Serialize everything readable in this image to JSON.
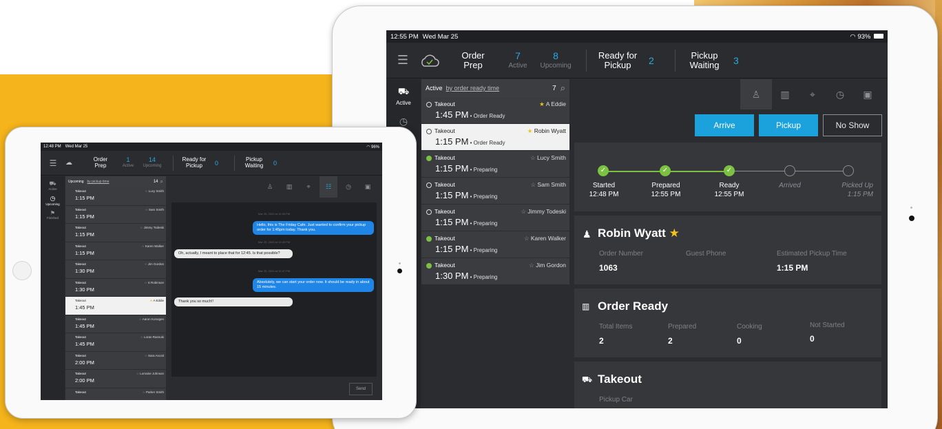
{
  "colors": {
    "accent": "#29a9e1",
    "green": "#7cc142",
    "gold": "#f3c21d",
    "yellow_bg": "#f5b41c"
  },
  "big": {
    "status": {
      "time": "12:55 PM",
      "date": "Wed Mar 25",
      "battery": "93%"
    },
    "header": {
      "order_prep": "Order\nPrep",
      "active_num": "7",
      "active_label": "Active",
      "upcoming_num": "8",
      "upcoming_label": "Upcoming",
      "ready_label": "Ready for\nPickup",
      "ready_num": "2",
      "waiting_label": "Pickup\nWaiting",
      "waiting_num": "3"
    },
    "sidebar": {
      "active_label": "Active"
    },
    "list": {
      "tab": "Active",
      "sort": "by order ready time",
      "count": "7",
      "rows": [
        {
          "type": "Takeout",
          "name": "A Eddie",
          "time": "1:45 PM",
          "status": "Order Ready",
          "starred": true,
          "dot": "empty",
          "selected": false
        },
        {
          "type": "Takeout",
          "name": "Robin Wyatt",
          "time": "1:15 PM",
          "status": "Order Ready",
          "starred": true,
          "dot": "empty",
          "selected": true
        },
        {
          "type": "Takeout",
          "name": "Lucy Smith",
          "time": "1:15 PM",
          "status": "Preparing",
          "starred": false,
          "dot": "green",
          "selected": false
        },
        {
          "type": "Takeout",
          "name": "Sam Smith",
          "time": "1:15 PM",
          "status": "Preparing",
          "starred": false,
          "dot": "empty",
          "selected": false
        },
        {
          "type": "Takeout",
          "name": "Jimmy Todeski",
          "time": "1:15 PM",
          "status": "Preparing",
          "starred": false,
          "dot": "empty",
          "selected": false
        },
        {
          "type": "Takeout",
          "name": "Karen Walker",
          "time": "1:15 PM",
          "status": "Preparing",
          "starred": false,
          "dot": "green",
          "selected": false
        },
        {
          "type": "Takeout",
          "name": "Jim Gordon",
          "time": "1:30 PM",
          "status": "Preparing",
          "starred": false,
          "dot": "green",
          "selected": false
        }
      ]
    },
    "buttons": {
      "arrive": "Arrive",
      "pickup": "Pickup",
      "no_show": "No Show"
    },
    "progress": {
      "steps": [
        {
          "label": "Started",
          "time": "12:48 PM",
          "done": true
        },
        {
          "label": "Prepared",
          "time": "12:55 PM",
          "done": true
        },
        {
          "label": "Ready",
          "time": "12:55 PM",
          "done": true
        },
        {
          "label": "Arrived",
          "time": "",
          "done": false
        },
        {
          "label": "Picked Up",
          "time": "1:15 PM",
          "done": false
        }
      ]
    },
    "customer": {
      "name": "Robin Wyatt",
      "order_number_label": "Order Number",
      "order_number": "1063",
      "guest_phone_label": "Guest Phone",
      "pickup_time_label": "Estimated Pickup Time",
      "pickup_time": "1:15 PM"
    },
    "order": {
      "title": "Order Ready",
      "total_label": "Total Items",
      "total": "2",
      "prepared_label": "Prepared",
      "prepared": "2",
      "cooking_label": "Cooking",
      "cooking": "0",
      "not_started_label": "Not Started",
      "not_started": "0"
    },
    "takeout": {
      "title": "Takeout",
      "pickup_car_label": "Pickup Car"
    }
  },
  "small": {
    "status": {
      "time": "12:48 PM",
      "date": "Wed Mar 25",
      "battery": "96%"
    },
    "header": {
      "order_prep": "Order\nPrep",
      "active_num": "1",
      "active_label": "Active",
      "upcoming_num": "14",
      "upcoming_label": "Upcoming",
      "ready_label": "Ready for\nPickup",
      "ready_num": "0",
      "waiting_label": "Pickup\nWaiting",
      "waiting_num": "0"
    },
    "sidebar": {
      "active": "Active",
      "upcoming": "Upcoming",
      "finished": "Finished"
    },
    "list": {
      "tab": "Upcoming",
      "sort": "by pickup time",
      "count": "14",
      "rows": [
        {
          "type": "Takeout",
          "name": "Lucy Smith",
          "time": "1:15 PM",
          "starred": false,
          "selected": false
        },
        {
          "type": "Takeout",
          "name": "Sam Smith",
          "time": "1:15 PM",
          "starred": false,
          "selected": false
        },
        {
          "type": "Takeout",
          "name": "Jimmy Todeski",
          "time": "1:15 PM",
          "starred": false,
          "selected": false
        },
        {
          "type": "Takeout",
          "name": "Karen Walker",
          "time": "1:15 PM",
          "starred": false,
          "selected": false
        },
        {
          "type": "Takeout",
          "name": "Jim Gordon",
          "time": "1:30 PM",
          "starred": false,
          "selected": false
        },
        {
          "type": "Takeout",
          "name": "S Robinson",
          "time": "1:30 PM",
          "starred": false,
          "selected": false
        },
        {
          "type": "Takeout",
          "name": "A Eddie",
          "time": "1:45 PM",
          "starred": true,
          "selected": true
        },
        {
          "type": "Takeout",
          "name": "Aaron Konogen",
          "time": "1:45 PM",
          "starred": false,
          "selected": false
        },
        {
          "type": "Takeout",
          "name": "Loran Rasnuki",
          "time": "1:45 PM",
          "starred": false,
          "selected": false
        },
        {
          "type": "Takeout",
          "name": "Sara Ascott",
          "time": "2:00 PM",
          "starred": false,
          "selected": false
        },
        {
          "type": "Takeout",
          "name": "Lorraine Johnson",
          "time": "2:00 PM",
          "starred": false,
          "selected": false
        },
        {
          "type": "Takeout",
          "name": "Parker Smith",
          "time": "",
          "starred": false,
          "selected": false
        }
      ]
    },
    "chat": {
      "ts1": "Mar 25, 2020 at 12:43 PM",
      "msg1": "Hello, this is The Friday Cafe. Just wanted to confirm your pickup order for 1:45pm today. Thank you.",
      "ts2": "Mar 25, 2020 at 12:45 PM",
      "msg2": "Oh, actually, I meant to place that for 12:45. Is that possible?",
      "ts3": "Mar 25, 2020 at 12:47 PM",
      "msg3": "Absolutely, we can start your order now. It should be ready in about 15 minutes.",
      "msg4": "Thank you so much!!",
      "send": "Send"
    }
  }
}
